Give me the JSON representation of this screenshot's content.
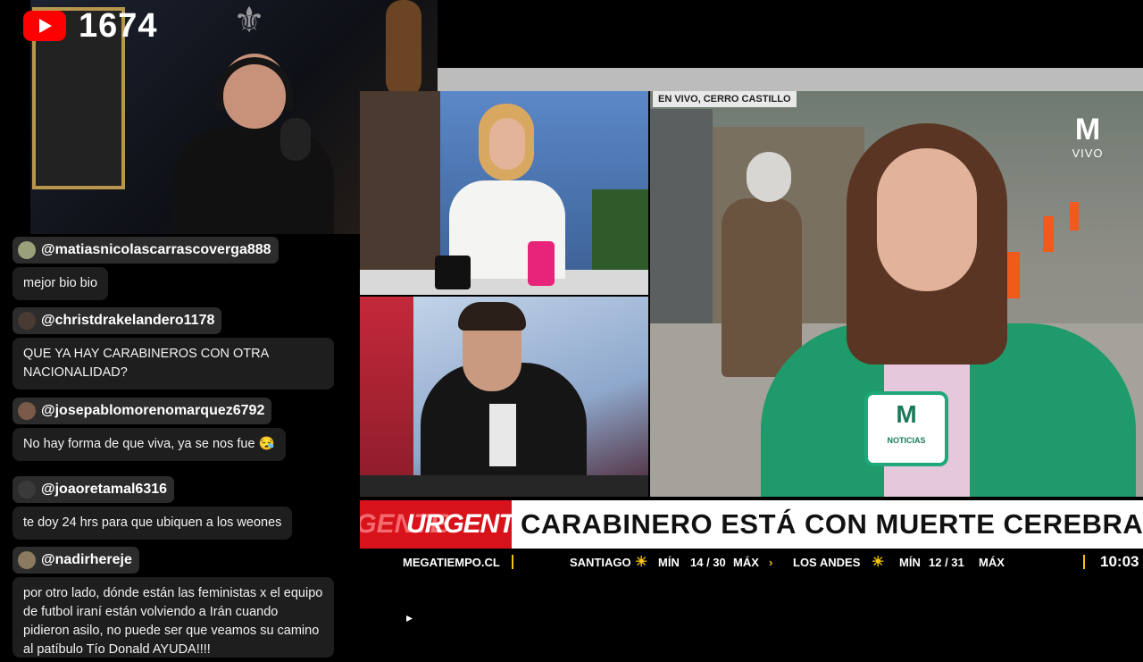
{
  "stream": {
    "viewer_count": "1674",
    "brand_color": "#ff0000",
    "badge_icon": "youtube-icon"
  },
  "chat": {
    "messages": [
      {
        "user": "@matiasnicolascarrascoverga888",
        "text": "mejor bio bio"
      },
      {
        "user": "@christdrakelandero1178",
        "text": "QUE YA HAY CARABINEROS CON OTRA NACIONALIDAD?"
      },
      {
        "user": "@josepablomorenomarquez6792",
        "text": "No hay forma de que viva, ya se nos fue 😪"
      },
      {
        "user": "@joaoretamal6316",
        "text": "te doy 24 hrs para que ubiquen a los weones"
      },
      {
        "user": "@nadirhereje",
        "text": "por otro lado, dónde están las feministas x el equipo de futbol iraní están volviendo a Irán cuando pidieron asilo, no puede ser que veamos su camino al patíbulo Tío Donald AYUDA!!!!"
      }
    ]
  },
  "broadcast": {
    "location_tag": "EN VIVO, CERRO CASTILLO",
    "logo_label": "VIVO",
    "mic_label": "NOTICIAS",
    "urgente": "URGENTE",
    "headline": "CARABINERO ESTÁ CON MUERTE CEREBRAL",
    "accent_red": "#d8121b",
    "ticker": {
      "source": "MEGATIEMPO.CL",
      "city1": "SANTIAGO",
      "min_label": "MÍN",
      "max_label": "MÁX",
      "city1_range": "14 / 30",
      "city2": "LOS ANDES",
      "city2_range": "12 / 31",
      "clock": "10:03"
    }
  }
}
